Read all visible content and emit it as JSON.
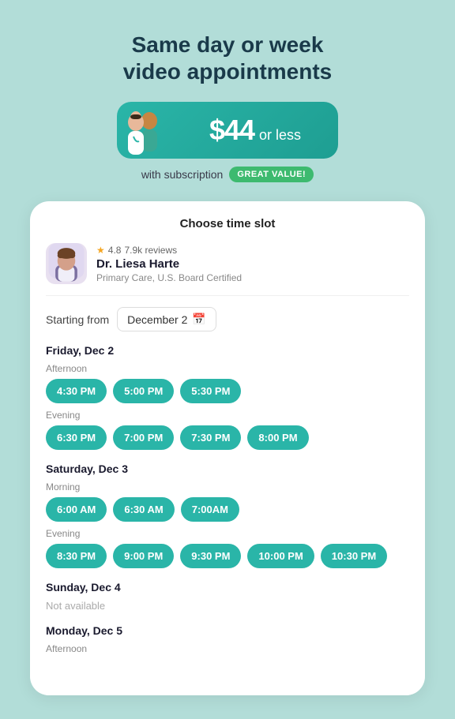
{
  "header": {
    "title_line1": "Same day or week",
    "title_line2": "video appointments"
  },
  "price_banner": {
    "price": "$44",
    "suffix": "or less",
    "subscription_text": "with subscription",
    "badge_text": "GREAT VALUE!"
  },
  "card": {
    "title": "Choose time slot",
    "doctor": {
      "rating": "4.8",
      "reviews": "7.9k reviews",
      "name": "Dr. Liesa Harte",
      "specialty": "Primary Care, U.S. Board Certified"
    },
    "starting_from_label": "Starting from",
    "date_value": "December 2",
    "days": [
      {
        "label": "Friday, Dec 2",
        "periods": [
          {
            "period": "Afternoon",
            "slots": [
              "4:30 PM",
              "5:00 PM",
              "5:30 PM"
            ]
          },
          {
            "period": "Evening",
            "slots": [
              "6:30 PM",
              "7:00 PM",
              "7:30 PM",
              "8:00 PM"
            ]
          }
        ]
      },
      {
        "label": "Saturday, Dec 3",
        "periods": [
          {
            "period": "Morning",
            "slots": [
              "6:00 AM",
              "6:30 AM",
              "7:00AM"
            ]
          },
          {
            "period": "Evening",
            "slots": [
              "8:30 PM",
              "9:00 PM",
              "9:30 PM",
              "10:00 PM",
              "10:30 PM"
            ]
          }
        ]
      },
      {
        "label": "Sunday, Dec 4",
        "not_available": true,
        "periods": []
      },
      {
        "label": "Monday, Dec 5",
        "periods": [
          {
            "period": "Afternoon",
            "slots": [
              "...",
              "...",
              "..."
            ]
          }
        ]
      }
    ]
  }
}
